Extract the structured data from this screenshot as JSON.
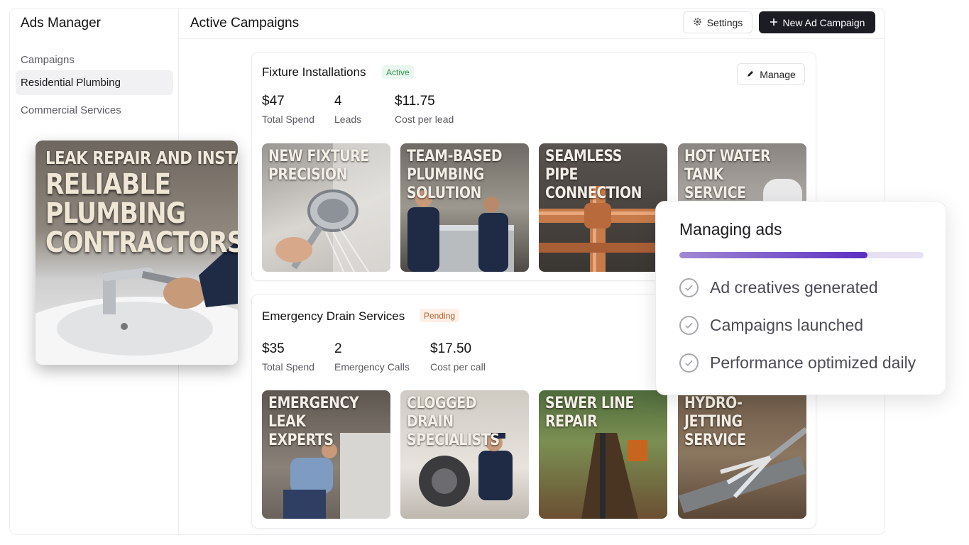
{
  "sidebar": {
    "title": "Ads Manager",
    "items": [
      {
        "label": "Campaigns"
      },
      {
        "label": "Residential Plumbing"
      },
      {
        "label": "Commercial Services"
      }
    ]
  },
  "header": {
    "title": "Active Campaigns",
    "settings_label": "Settings",
    "new_campaign_label": "New Ad Campaign"
  },
  "campaigns": [
    {
      "title": "Fixture Installations",
      "status": "Active",
      "manage_label": "Manage",
      "stats": [
        {
          "value": "$47",
          "label": "Total Spend"
        },
        {
          "value": "4",
          "label": "Leads"
        },
        {
          "value": "$11.75",
          "label": "Cost per lead"
        }
      ],
      "creatives": [
        {
          "caption": "NEW FIXTURE\nPRECISION"
        },
        {
          "caption": "TEAM-BASED\nPLUMBING SOLUTION"
        },
        {
          "caption": "SEAMLESS\nPIPE CONNECTION"
        },
        {
          "caption": "HOT WATER\nTANK SERVICE"
        }
      ]
    },
    {
      "title": "Emergency Drain Services",
      "status": "Pending",
      "stats": [
        {
          "value": "$35",
          "label": "Total Spend"
        },
        {
          "value": "2",
          "label": "Emergency Calls"
        },
        {
          "value": "$17.50",
          "label": "Cost per call"
        }
      ],
      "creatives": [
        {
          "caption": "EMERGENCY LEAK\nEXPERTS"
        },
        {
          "caption": "CLOGGED DRAIN\nSPECIALISTS"
        },
        {
          "caption": "SEWER LINE\nREPAIR"
        },
        {
          "caption": "HYDRO-JETTING\nSERVICE"
        }
      ]
    }
  ],
  "featured_ad": {
    "line1": "LEAK REPAIR AND INSTALLS",
    "line2": "RELIABLE\nPLUMBING\nCONTRACTORS"
  },
  "progress": {
    "title": "Managing ads",
    "fraction": 0.77,
    "steps": [
      {
        "label": "Ad creatives generated"
      },
      {
        "label": "Campaigns launched"
      },
      {
        "label": "Performance optimized daily"
      }
    ]
  },
  "colors": {
    "primary_button": "#1c1c24",
    "active_badge": "#2f9a52",
    "pending_badge": "#b7602e",
    "progress_accent": "#5b2fc2"
  }
}
